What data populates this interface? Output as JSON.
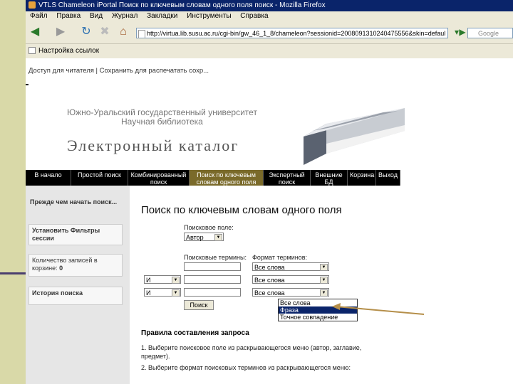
{
  "window": {
    "title": "VTLS Chameleon iPortal Поиск по ключевым словам одного поля поиск - Mozilla Firefox"
  },
  "menu": [
    "Файл",
    "Правка",
    "Вид",
    "Журнал",
    "Закладки",
    "Инструменты",
    "Справка"
  ],
  "nav": {
    "url": "http://virtua.lib.susu.ac.ru/cgi-bin/gw_46_1_8/chameleon?sessionid=2008091310240475556&skin=defaul",
    "search_placeholder": "Google"
  },
  "bookmarks": {
    "item": "Настройка ссылок"
  },
  "page": {
    "top_links": "Доступ для читателя | Сохранить для распечатать сохр...",
    "university_line1": "Южно-Уральский государственный университет",
    "university_line2": "Научная библиотека",
    "catalog_title": "Электронный каталог",
    "nav_tabs": [
      {
        "line1": "В начало",
        "line2": ""
      },
      {
        "line1": "Простой поиск",
        "line2": ""
      },
      {
        "line1": "Комбинированный",
        "line2": "поиск"
      },
      {
        "line1": "Поиск по ключевым",
        "line2": "словам одного поля"
      },
      {
        "line1": "Экспертный",
        "line2": "поиск"
      },
      {
        "line1": "Внешние",
        "line2": "БД"
      },
      {
        "line1": "Корзина",
        "line2": ""
      },
      {
        "line1": "Выход",
        "line2": ""
      }
    ],
    "sidebar": {
      "before_start": "Прежде чем начать поиск...",
      "filters": "Установить Фильтры сессии",
      "cart_count_label": "Количество записей в корзине:",
      "cart_count_value": "0",
      "history": "История поиска"
    },
    "form": {
      "heading": "Поиск по ключевым словам одного поля",
      "field_label": "Поисковое поле:",
      "field_value": "Автор",
      "terms_label": "Поисковые термины:",
      "format_label": "Формат терминов:",
      "format_value": "Все слова",
      "operator_value": "И",
      "search_button": "Поиск",
      "dropdown_options": [
        "Все слова",
        "Фраза",
        "Точное совпадение"
      ],
      "dropdown_selected_index": 1
    },
    "rules": {
      "title": "Правила составления запроса",
      "rule1": "1. Выберите поисковое поле из раскрывающегося меню (автор, заглавие, предмет).",
      "rule2": "2. Выберите формат поисковых терминов из раскрывающегося меню:"
    }
  },
  "colors": {
    "titlebar": "#0a246a",
    "navstrip": "#000000",
    "slide_bar": "#d9d9a8",
    "arrow": "#b58f4a"
  }
}
